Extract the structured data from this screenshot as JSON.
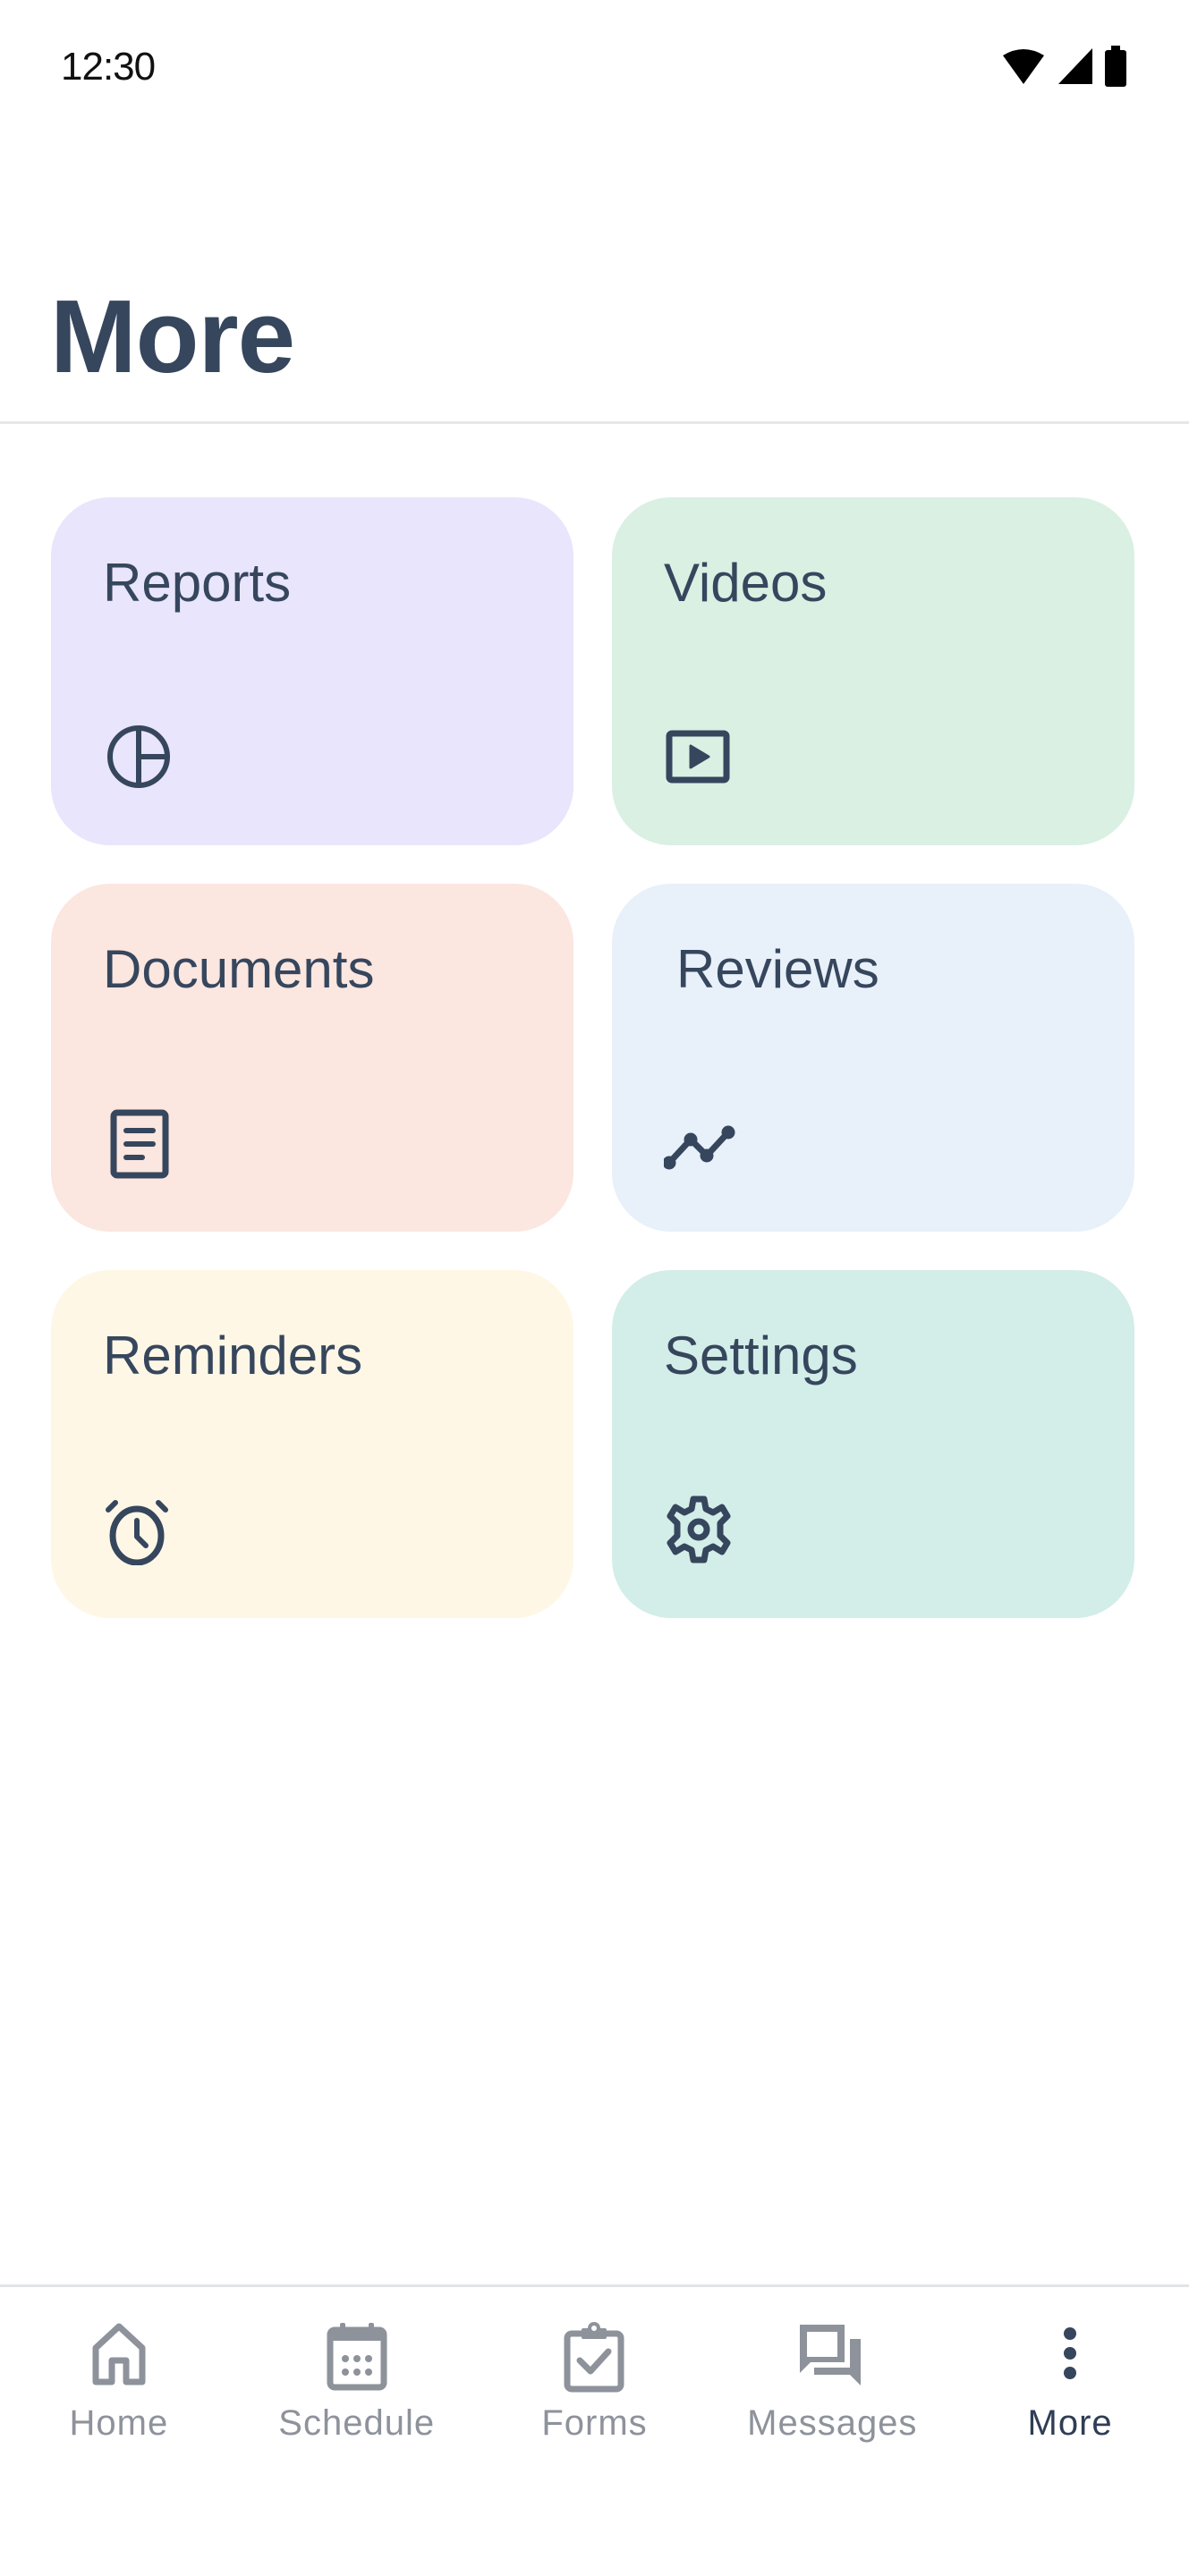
{
  "status_bar": {
    "time": "12:30",
    "icons": [
      "wifi-icon",
      "cellular-signal-icon",
      "battery-icon"
    ]
  },
  "header": {
    "title": "More"
  },
  "colors": {
    "text_primary": "#36465d",
    "nav_inactive": "#8d929b",
    "nav_active": "#2f3d55",
    "divider": "#e6e7ea"
  },
  "tiles": [
    {
      "label": "Reports",
      "icon": "pie-chart-icon",
      "background": "#e8e5fc"
    },
    {
      "label": "Videos",
      "icon": "video-play-icon",
      "background": "#d9f0e3"
    },
    {
      "label": "Documents",
      "icon": "document-icon",
      "background": "#fbe6e0"
    },
    {
      "label": "Reviews",
      "icon": "line-chart-icon",
      "background": "#e8f0fa"
    },
    {
      "label": "Reminders",
      "icon": "alarm-clock-icon",
      "background": "#fff7e6"
    },
    {
      "label": "Settings",
      "icon": "gear-icon",
      "background": "#d3ede8"
    }
  ],
  "bottom_nav": {
    "items": [
      {
        "label": "Home",
        "icon": "home-icon",
        "active": false
      },
      {
        "label": "Schedule",
        "icon": "calendar-icon",
        "active": false
      },
      {
        "label": "Forms",
        "icon": "clipboard-check-icon",
        "active": false
      },
      {
        "label": "Messages",
        "icon": "chat-bubbles-icon",
        "active": false
      },
      {
        "label": "More",
        "icon": "more-vertical-icon",
        "active": true
      }
    ]
  }
}
